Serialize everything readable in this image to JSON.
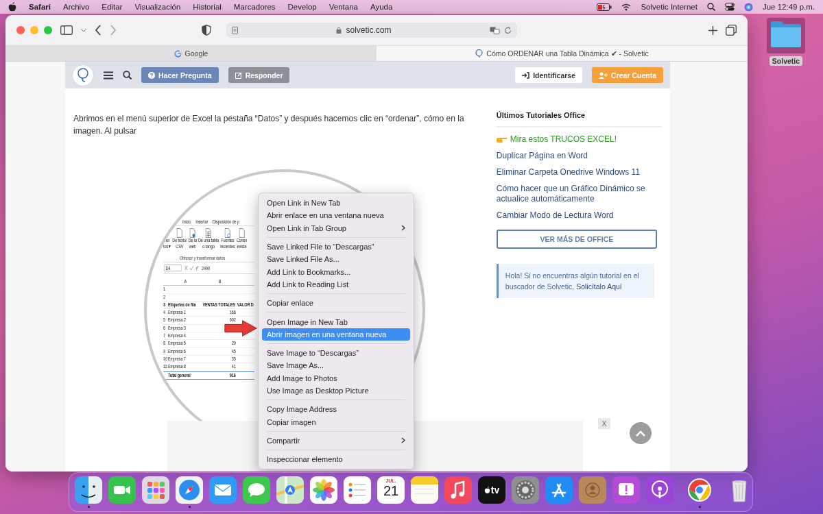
{
  "menu_bar": {
    "app": "Safari",
    "menus": [
      "Archivo",
      "Editar",
      "Visualización",
      "Historial",
      "Marcadores",
      "Develop",
      "Ventana",
      "Ayuda"
    ],
    "network": "Solvetic Internet",
    "clock": "Jue 12:49 p.m."
  },
  "desktop_icons": [
    {
      "label": "Solvetic",
      "selected": true
    }
  ],
  "browser": {
    "address": "solvetic.com",
    "tabs": [
      {
        "title": "Google",
        "selected": false,
        "kind": "google"
      },
      {
        "title": "Cómo ORDENAR una Tabla Dinámica ✔ - Solvetic",
        "selected": true,
        "kind": "site"
      }
    ]
  },
  "site_header": {
    "buttons": [
      {
        "label": "Hacer Pregunta",
        "kind": "ask"
      },
      {
        "label": "Responder",
        "kind": "answer"
      },
      {
        "label": "Identificarse",
        "kind": "login"
      },
      {
        "label": "Crear Cuenta",
        "kind": "signup"
      }
    ]
  },
  "article": {
    "text": "Abrimos en el menú superior de Excel la pestaña “Datos” y después hacemos clic en “ordenar”, cómo en la imagen. Al pulsar",
    "excel": {
      "ribbon_tabs": [
        "Inicio",
        "Insertar",
        "Disposición de p"
      ],
      "ribbon_buttons": [
        {
          "lines": [
            "ner",
            "tos ▾"
          ]
        },
        {
          "lines": [
            "De texto/",
            "CSV"
          ]
        },
        {
          "lines": [
            "De la",
            "web"
          ]
        },
        {
          "lines": [
            "De una tabla",
            "o rango"
          ]
        },
        {
          "lines": [
            "Fuentes",
            "recientes"
          ]
        },
        {
          "lines": [
            "Conex",
            "existe"
          ]
        }
      ],
      "group_label": "Obtener y transformar datos",
      "name_box": "D4",
      "formula": "2490",
      "columns": [
        "A",
        "B"
      ],
      "rows": [
        {
          "n": "1"
        },
        {
          "n": "2"
        },
        {
          "n": "3",
          "a": "Etiquetas de fila",
          "b": "VENTAS TOTALES",
          "c": "VALOR D",
          "kind": "header"
        },
        {
          "n": "4",
          "a": "Empresa 1",
          "b": "166"
        },
        {
          "n": "5",
          "a": "Empresa 2",
          "b": "602"
        },
        {
          "n": "6",
          "a": "Empresa 3"
        },
        {
          "n": "7",
          "a": "Empresa 4"
        },
        {
          "n": "8",
          "a": "Empresa 5",
          "b": "20"
        },
        {
          "n": "9",
          "a": "Empresa 6",
          "b": "45"
        },
        {
          "n": "10",
          "a": "Empresa 7",
          "b": "35"
        },
        {
          "n": "11",
          "a": "Empresa 8",
          "b": "41"
        },
        {
          "a": "Total general",
          "b": "916",
          "kind": "total"
        }
      ]
    }
  },
  "context_menu": {
    "groups": [
      [
        {
          "label": "Open Link in New Tab",
          "selected": false,
          "submenu": false
        },
        {
          "label": "Abrir enlace en una ventana nueva",
          "selected": false,
          "submenu": false
        },
        {
          "label": "Open Link in Tab Group",
          "selected": false,
          "submenu": true
        }
      ],
      [
        {
          "label": "Save Linked File to “Descargas”",
          "selected": false,
          "submenu": false
        },
        {
          "label": "Save Linked File As...",
          "selected": false,
          "submenu": false
        },
        {
          "label": "Add Link to Bookmarks...",
          "selected": false,
          "submenu": false
        },
        {
          "label": "Add Link to Reading List",
          "selected": false,
          "submenu": false
        }
      ],
      [
        {
          "label": "Copiar enlace",
          "selected": false,
          "submenu": false
        }
      ],
      [
        {
          "label": "Open Image in New Tab",
          "selected": false,
          "submenu": false
        },
        {
          "label": "Abrir imagen en una ventana nueva",
          "selected": true,
          "submenu": false
        }
      ],
      [
        {
          "label": "Save Image to “Descargas”",
          "selected": false,
          "submenu": false
        },
        {
          "label": "Save Image As...",
          "selected": false,
          "submenu": false
        },
        {
          "label": "Add Image to Photos",
          "selected": false,
          "submenu": false
        },
        {
          "label": "Use Image as Desktop Picture",
          "selected": false,
          "submenu": false
        }
      ],
      [
        {
          "label": "Copy Image Address",
          "selected": false,
          "submenu": false
        },
        {
          "label": "Copiar imagen",
          "selected": false,
          "submenu": false
        }
      ],
      [
        {
          "label": "Compartir",
          "selected": false,
          "submenu": true
        }
      ],
      [
        {
          "label": "Inspeccionar elemento",
          "selected": false,
          "submenu": false
        }
      ]
    ]
  },
  "sidebar": {
    "heading": "Últimos Tutoriales Office",
    "links": [
      {
        "label": "Mira estos TRUCOS EXCEL!",
        "kind": "promo"
      },
      {
        "label": "Duplicar Página en Word",
        "kind": "link"
      },
      {
        "label": "Eliminar Carpeta Onedrive Windows 11",
        "kind": "link"
      },
      {
        "label": "Cómo hacer que un Gráfico Dinámico se actualice automáticamente",
        "kind": "link"
      },
      {
        "label": "Cambiar Modo de Lectura Word",
        "kind": "link"
      }
    ],
    "button": "VER MÁS DE OFFICE",
    "notice": {
      "text": "Hola! Si no encuentras algún tutorial en el buscador de Solvetic,",
      "link": "Solicítalo Aquí"
    }
  },
  "ad": {
    "close": "X"
  },
  "dock": {
    "apps": [
      {
        "kind": "finder",
        "running": true
      },
      {
        "kind": "facetime",
        "running": false
      },
      {
        "kind": "launchpad",
        "running": false
      },
      {
        "kind": "safari",
        "running": true
      },
      {
        "kind": "mail",
        "running": false
      },
      {
        "kind": "messages",
        "running": false
      },
      {
        "kind": "maps",
        "running": false
      },
      {
        "kind": "photos",
        "running": false
      },
      {
        "kind": "reminders",
        "running": false
      },
      {
        "kind": "calendar",
        "month": "JUL.",
        "day": "21",
        "running": false
      },
      {
        "kind": "notes",
        "running": false
      },
      {
        "kind": "music",
        "running": false
      },
      {
        "kind": "tv",
        "label": "tv",
        "running": false
      },
      {
        "kind": "settings",
        "running": false
      },
      {
        "kind": "appstore",
        "running": false
      },
      {
        "kind": "contacts",
        "running": false
      },
      {
        "kind": "feedback",
        "running": false
      },
      {
        "kind": "podcasts",
        "running": false
      },
      {
        "kind": "separator"
      },
      {
        "kind": "chrome",
        "running": true
      },
      {
        "kind": "separator"
      },
      {
        "kind": "trash",
        "running": false
      }
    ]
  }
}
